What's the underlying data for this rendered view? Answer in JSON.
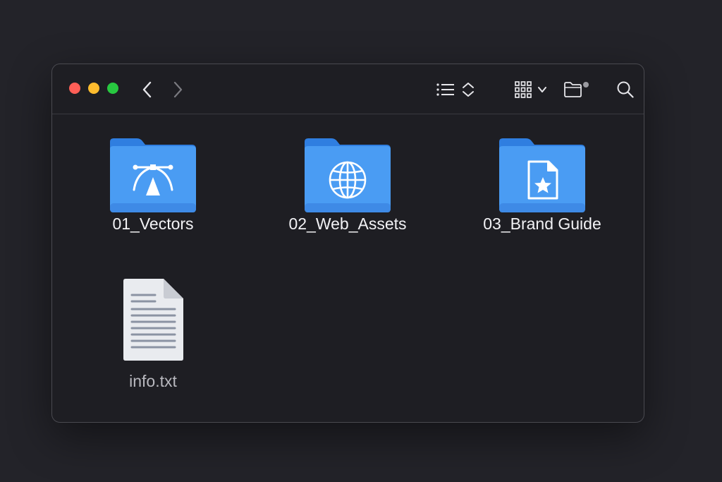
{
  "window": {
    "colors": {
      "background": "#1e1e23",
      "folder_front": "#4a9cf3",
      "folder_back": "#2f7ee0",
      "close": "#ff5f57",
      "minimize": "#febc2e",
      "zoom": "#28c840"
    }
  },
  "toolbar": {
    "icons": [
      "chevron-left-icon",
      "chevron-right-icon",
      "list-view-icon",
      "sort-updown-icon",
      "grid-view-icon",
      "chevron-down-icon",
      "new-folder-icon",
      "search-icon"
    ]
  },
  "items": [
    {
      "name": "01_Vectors",
      "kind": "folder",
      "icon": "vector-pen-icon"
    },
    {
      "name": "02_Web_Assets",
      "kind": "folder",
      "icon": "globe-icon"
    },
    {
      "name": "03_Brand Guide",
      "kind": "folder",
      "icon": "star-document-icon"
    },
    {
      "name": "info.txt",
      "kind": "file",
      "icon": "text-document-icon"
    }
  ]
}
